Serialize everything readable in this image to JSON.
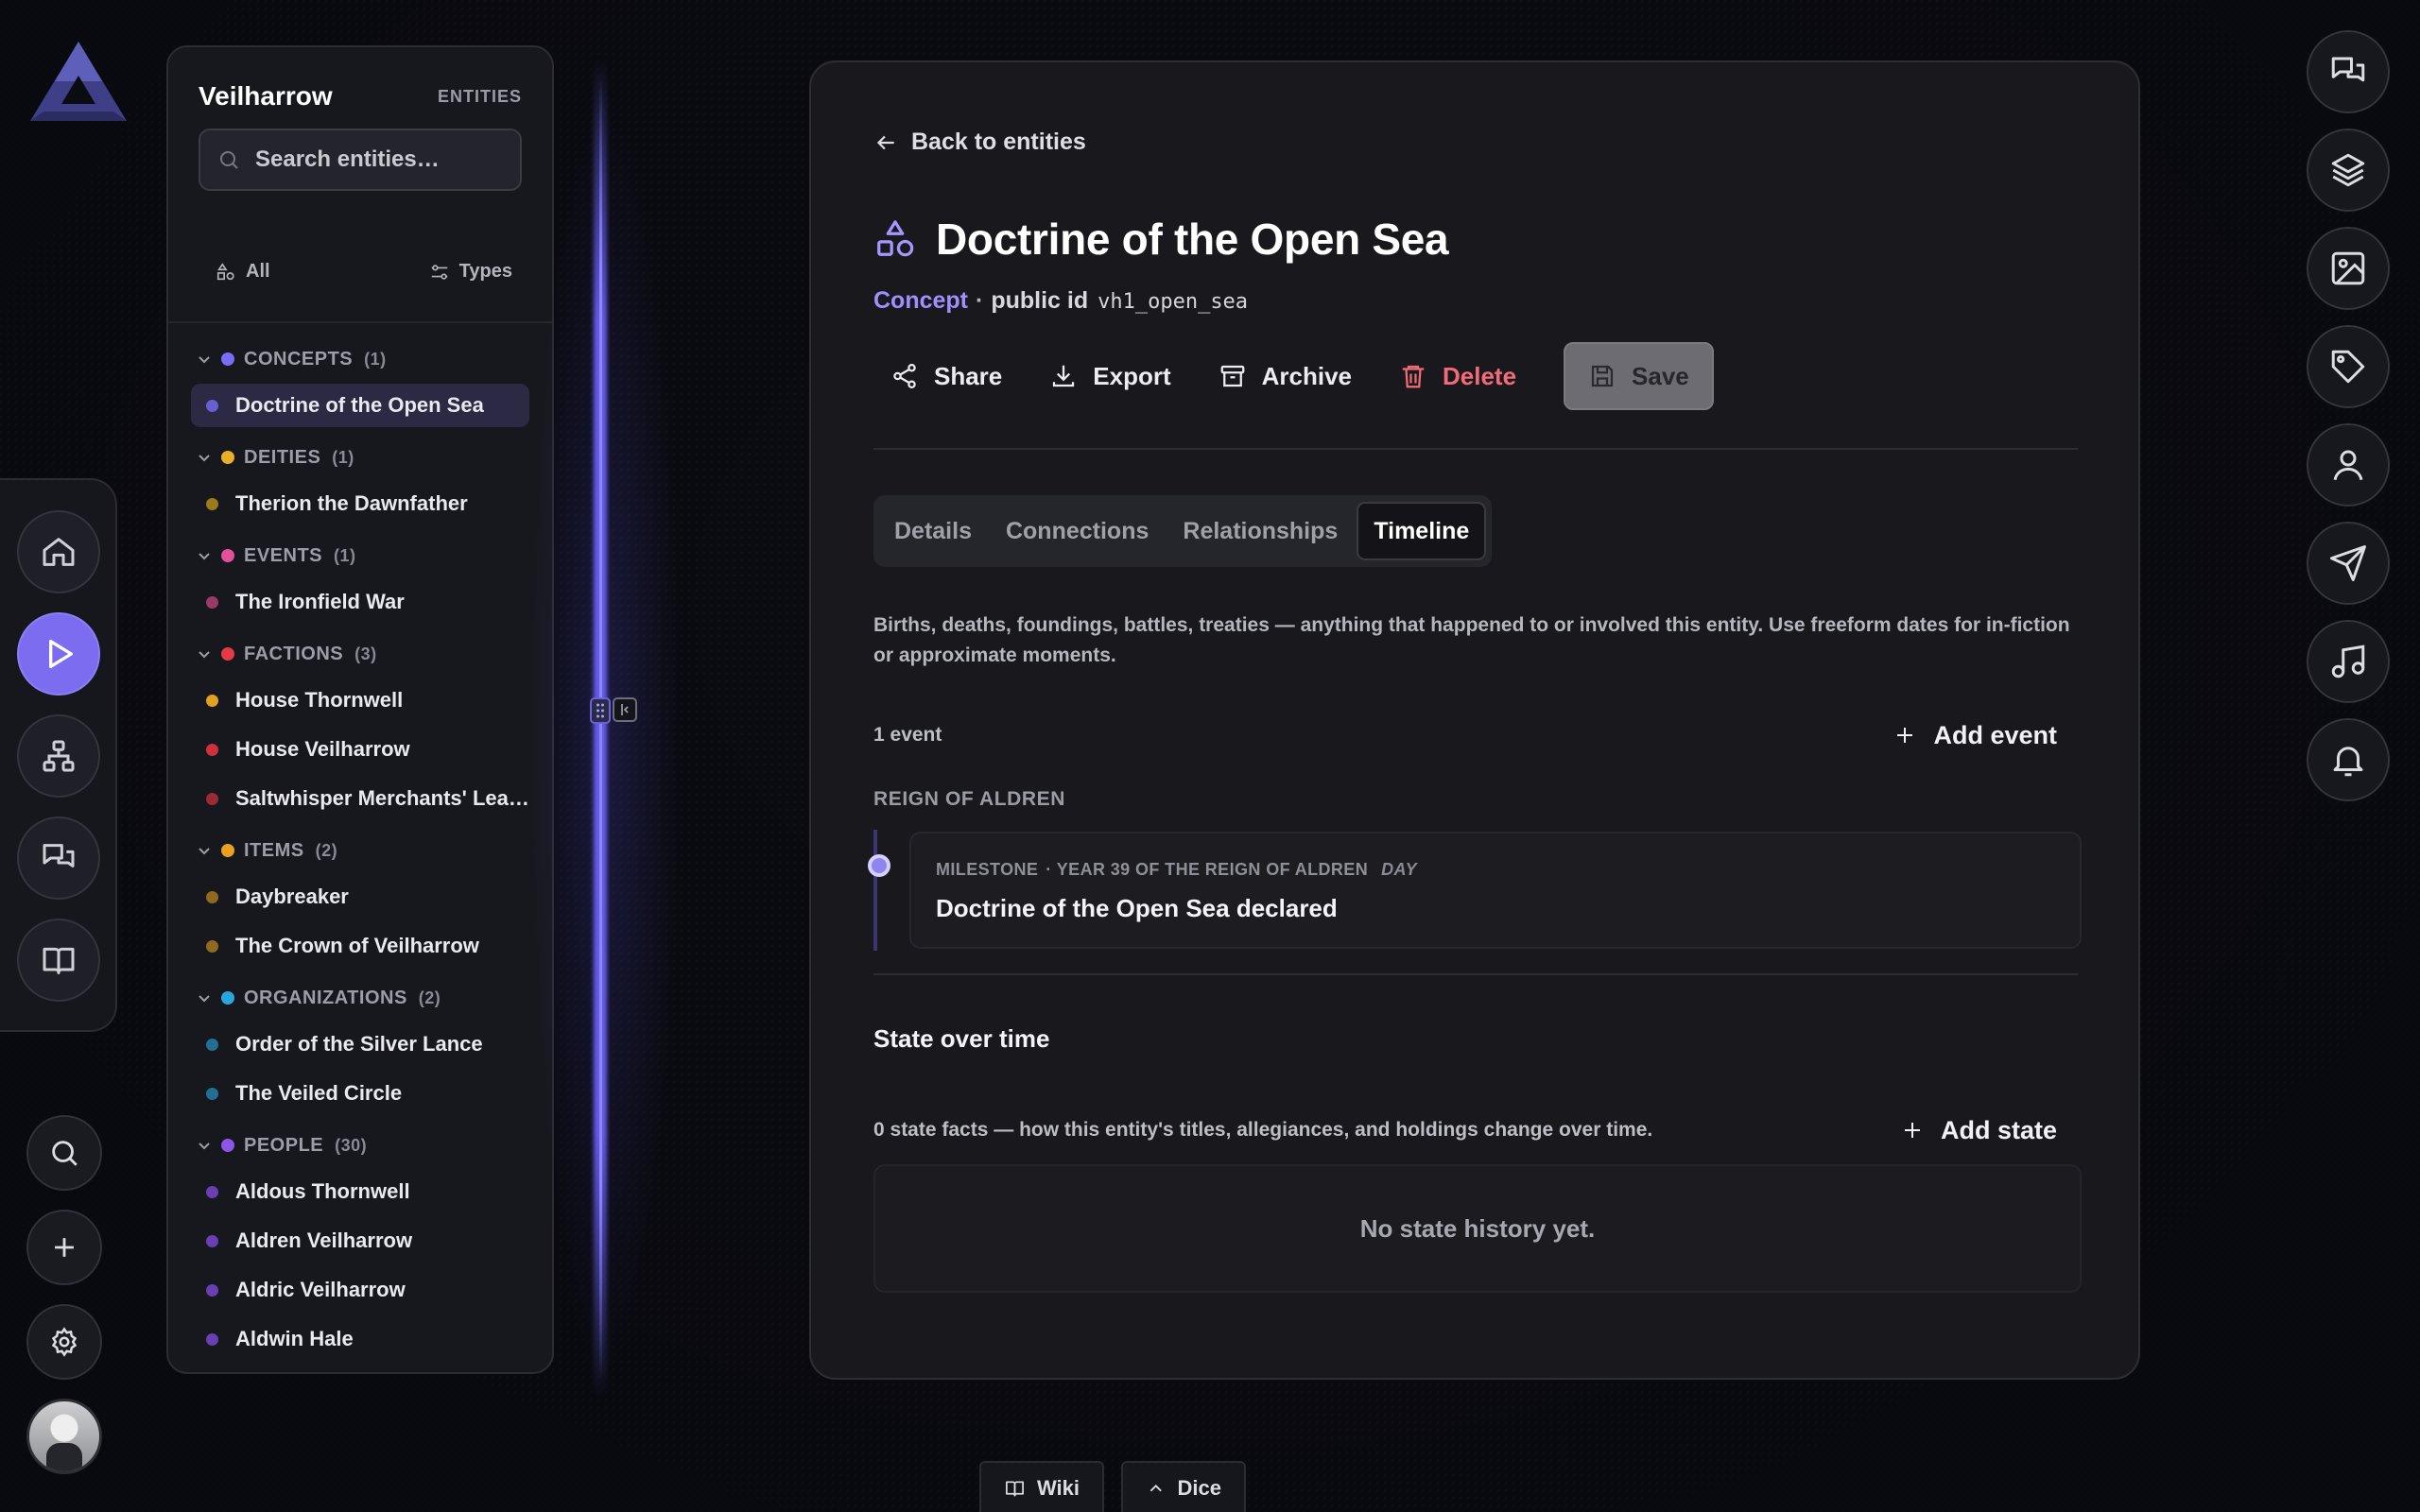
{
  "colors": {
    "accent": "#7b6cf0",
    "type_label": "#9e91ff",
    "danger": "#f26b78",
    "concepts": "#7a6cf5",
    "deities": "#e8b024",
    "events": "#e2519a",
    "factions": "#e53a46",
    "items": "#eaa020",
    "organizations": "#28a7de",
    "people": "#8e55e6"
  },
  "sidebar": {
    "title": "Veilharrow",
    "subtitle": "ENTITIES",
    "search_placeholder": "Search entities…",
    "filter_all": "All",
    "filter_types": "Types",
    "groups": [
      {
        "label": "CONCEPTS",
        "count": "(1)",
        "color": "#7a6cf5",
        "items": [
          {
            "label": "Doctrine of the Open Sea",
            "color": "#6a5fd0",
            "selected": true
          }
        ]
      },
      {
        "label": "DEITIES",
        "count": "(1)",
        "color": "#e8b024",
        "items": [
          {
            "label": "Therion the Dawnfather",
            "color": "#9b7a1c"
          }
        ]
      },
      {
        "label": "EVENTS",
        "count": "(1)",
        "color": "#e2519a",
        "items": [
          {
            "label": "The Ironfield War",
            "color": "#9a3a66"
          }
        ]
      },
      {
        "label": "FACTIONS",
        "count": "(3)",
        "color": "#e53a46",
        "items": [
          {
            "label": "House Thornwell",
            "color": "#e0a022"
          },
          {
            "label": "House Veilharrow",
            "color": "#d22f3e"
          },
          {
            "label": "Saltwhisper Merchants' League",
            "color": "#9a2a34"
          }
        ]
      },
      {
        "label": "ITEMS",
        "count": "(2)",
        "color": "#eaa020",
        "items": [
          {
            "label": "Daybreaker",
            "color": "#8f6a1e"
          },
          {
            "label": "The Crown of Veilharrow",
            "color": "#8f6a1e"
          }
        ]
      },
      {
        "label": "ORGANIZATIONS",
        "count": "(2)",
        "color": "#28a7de",
        "items": [
          {
            "label": "Order of the Silver Lance",
            "color": "#226f93"
          },
          {
            "label": "The Veiled Circle",
            "color": "#226f93"
          }
        ]
      },
      {
        "label": "PEOPLE",
        "count": "(30)",
        "color": "#8e55e6",
        "items": [
          {
            "label": "Aldous Thornwell",
            "color": "#6a3fb4"
          },
          {
            "label": "Aldren Veilharrow",
            "color": "#6a3fb4"
          },
          {
            "label": "Aldric Veilharrow",
            "color": "#6a3fb4"
          },
          {
            "label": "Aldwin Hale",
            "color": "#6a3fb4"
          }
        ]
      }
    ]
  },
  "main": {
    "back_label": "Back to entities",
    "title": "Doctrine of the Open Sea",
    "type": "Concept",
    "separator": "·",
    "public_id_label": "public id",
    "public_id": "vh1_open_sea",
    "actions": {
      "share": "Share",
      "export": "Export",
      "archive": "Archive",
      "delete": "Delete",
      "save": "Save"
    },
    "tabs": [
      "Details",
      "Connections",
      "Relationships",
      "Timeline"
    ],
    "active_tab": "Timeline",
    "timeline_description": "Births, deaths, foundings, battles, treaties — anything that happened to or involved this entity. Use freeform dates for in-fiction or approximate moments.",
    "event_count": "1 event",
    "add_event_label": "Add event",
    "era_label": "REIGN OF ALDREN",
    "event": {
      "kind": "MILESTONE",
      "date": "· YEAR 39 OF THE REIGN OF ALDREN",
      "precision": "DAY",
      "title": "Doctrine of the Open Sea declared"
    },
    "state_section_title": "State over time",
    "state_count_text": "0 state facts — how this entity's titles, allegiances, and holdings change over time.",
    "add_state_label": "Add state",
    "state_empty": "No state history yet."
  },
  "left_rail": {
    "icons": [
      "home-icon",
      "play-icon",
      "network-icon",
      "chat-icon",
      "book-icon",
      "search-icon",
      "plus-icon",
      "gear-icon"
    ]
  },
  "right_rail": {
    "icons": [
      "chat-icon",
      "layers-icon",
      "image-icon",
      "tag-icon",
      "user-icon",
      "send-icon",
      "music-icon",
      "bell-icon"
    ]
  },
  "bottom_bar": {
    "wiki_label": "Wiki",
    "dice_label": "Dice"
  }
}
